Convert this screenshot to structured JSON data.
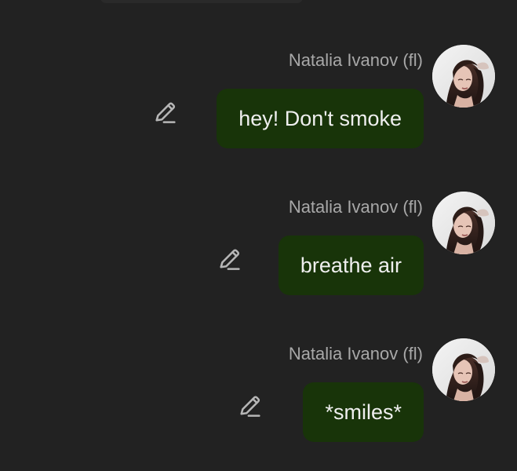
{
  "messages": [
    {
      "sender": "Natalia Ivanov (fl)",
      "text": "hey! Don't smoke"
    },
    {
      "sender": "Natalia Ivanov (fl)",
      "text": "breathe air"
    },
    {
      "sender": "Natalia Ivanov (fl)",
      "text": "*smiles*"
    }
  ],
  "icons": {
    "edit": "pencil-edit-icon",
    "avatar": "avatar"
  },
  "colors": {
    "background": "#222222",
    "bubble": "#183409",
    "sender_text": "#a8a8a8",
    "message_text": "#efefef",
    "icon": "#b6b6b6"
  }
}
